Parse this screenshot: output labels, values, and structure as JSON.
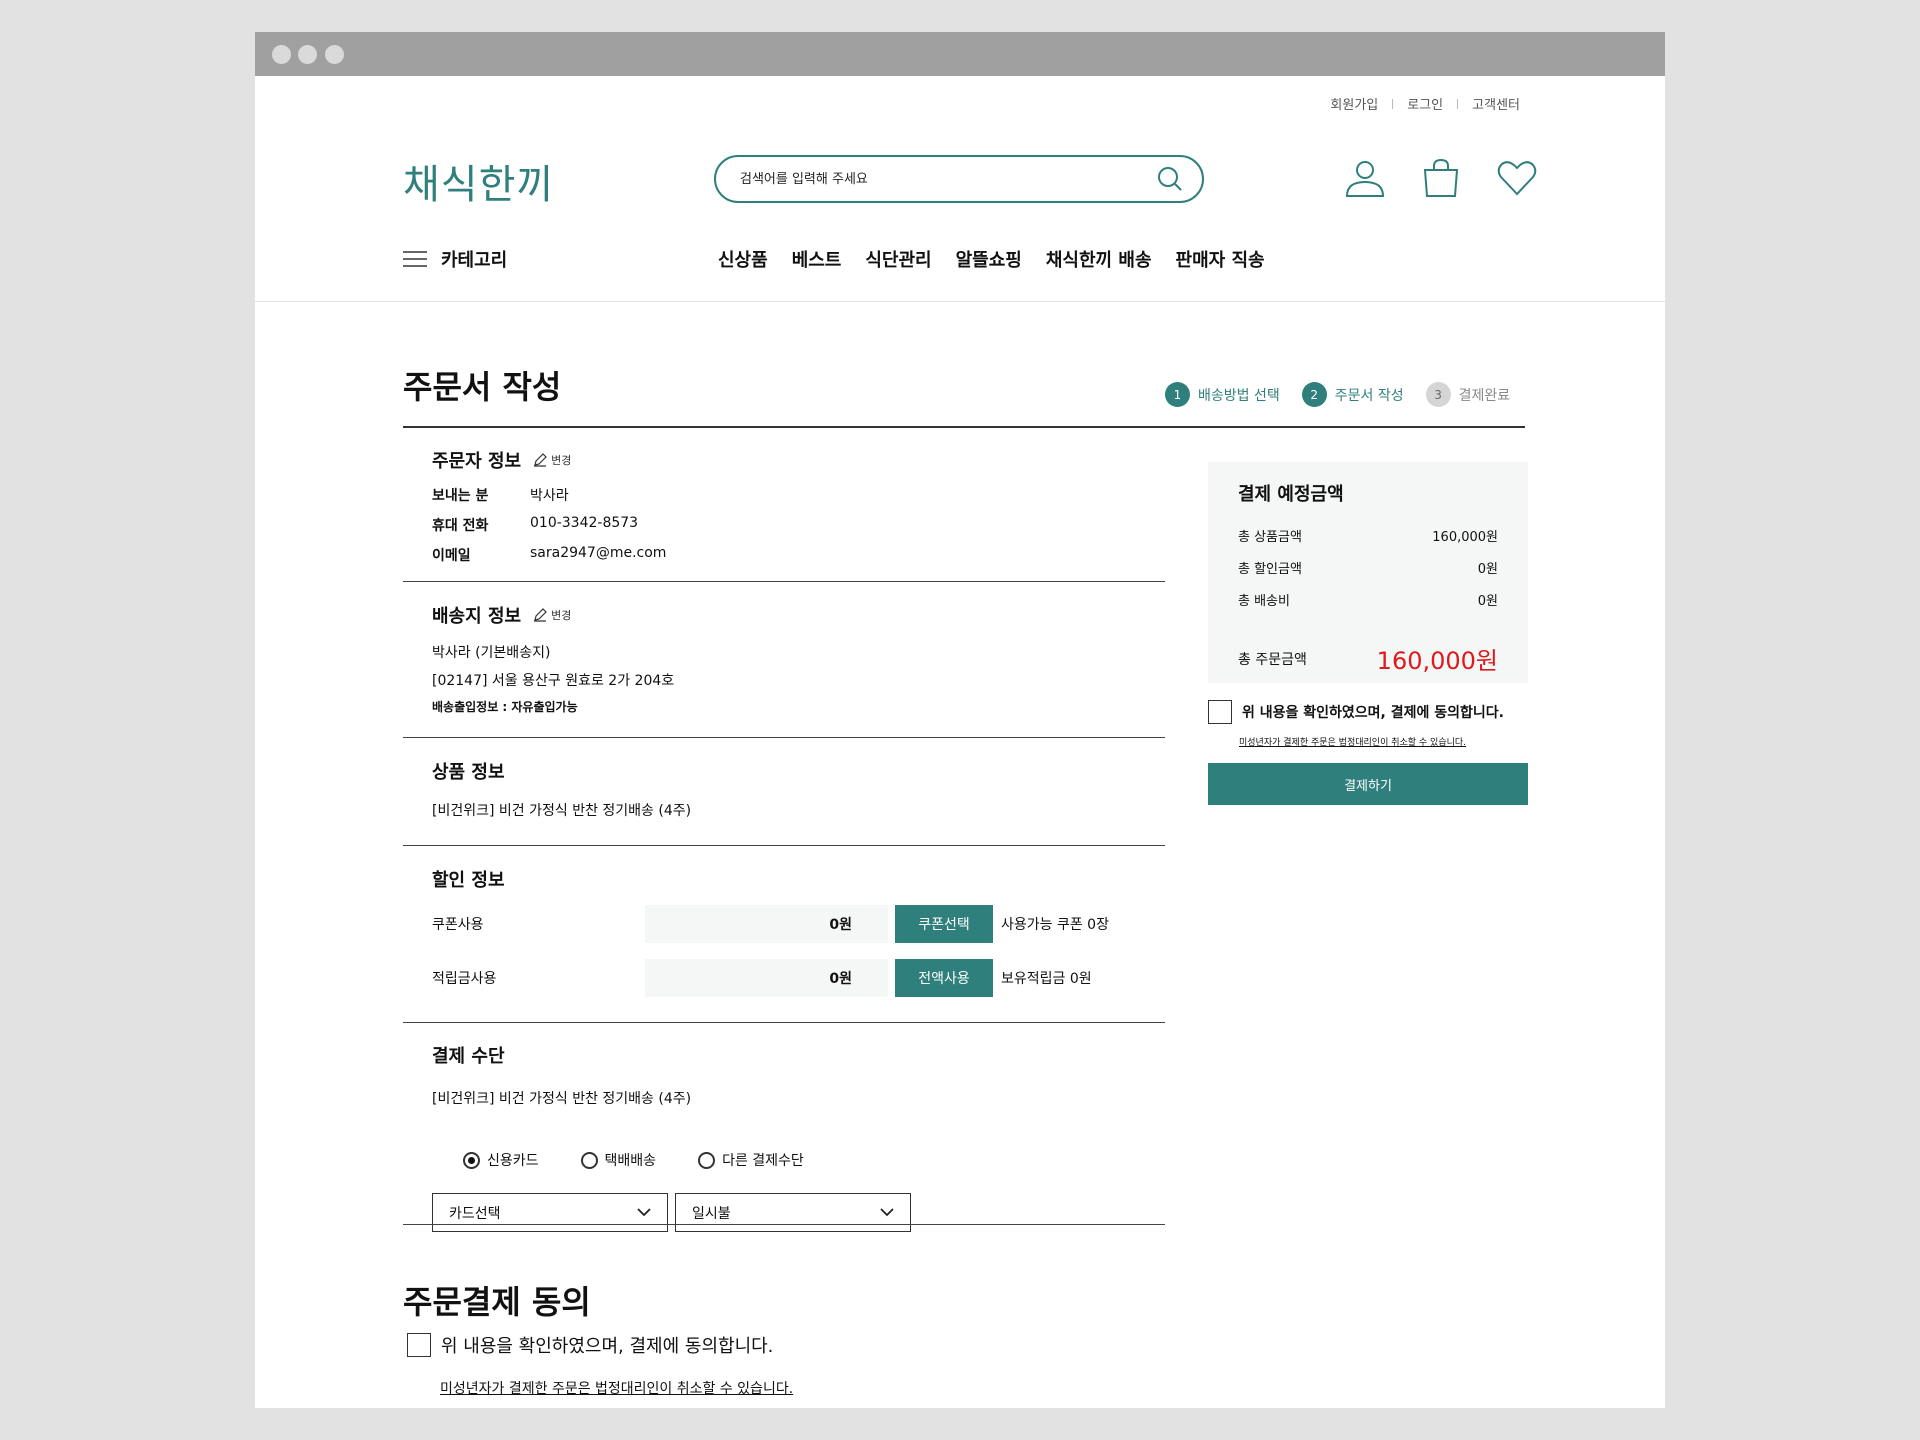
{
  "util_links": [
    "회원가입",
    "로그인",
    "고객센터"
  ],
  "logo": "채식한끼",
  "search": {
    "placeholder": "검색어를 입력해 주세요"
  },
  "nav": {
    "category_label": "카테고리",
    "menu": [
      "신상품",
      "베스트",
      "식단관리",
      "알뜰쇼핑",
      "채식한끼 배송",
      "판매자 직송"
    ]
  },
  "page": {
    "title": "주문서 작성"
  },
  "steps": [
    {
      "num": "1",
      "label": "배송방법 선택"
    },
    {
      "num": "2",
      "label": "주문서 작성"
    },
    {
      "num": "3",
      "label": "결제완료"
    }
  ],
  "orderer": {
    "title": "주문자 정보",
    "edit_label": "변경",
    "rows": [
      {
        "k": "보내는 분",
        "v": "박사라"
      },
      {
        "k": "휴대 전화",
        "v": "010-3342-8573"
      },
      {
        "k": "이메일",
        "v": "sara2947@me.com"
      }
    ]
  },
  "shipping": {
    "title": "배송지 정보",
    "edit_label": "변경",
    "name": "박사라 (기본배송지)",
    "address": "[02147] 서울 용산구 원효로 2가 204호",
    "entry_info": "배송출입정보 : 자유출입가능"
  },
  "product": {
    "title": "상품 정보",
    "name": "[비건위크] 비건 가정식 반찬 정기배송 (4주)"
  },
  "discount": {
    "title": "할인 정보",
    "coupon": {
      "label": "쿠폰사용",
      "value": "0원",
      "button": "쿠폰선택",
      "note": "사용가능 쿠폰 0장"
    },
    "points": {
      "label": "적립금사용",
      "value": "0원",
      "button": "전액사용",
      "note": "보유적립금 0원"
    }
  },
  "payment": {
    "title": "결제 수단",
    "product_name": "[비건위크] 비건 가정식 반찬 정기배송 (4주)",
    "methods": [
      "신용카드",
      "택배배송",
      "다른 결제수단"
    ],
    "card_select": "카드선택",
    "installment_select": "일시불"
  },
  "agreement": {
    "title": "주문결제 동의",
    "agree_text": "위 내용을 확인하였으며, 결제에 동의합니다.",
    "minor_notice": "미성년자가 결제한 주문은 법정대리인이 취소할 수 있습니다."
  },
  "summary": {
    "title": "결제 예정금액",
    "rows": [
      {
        "k": "총 상품금액",
        "v": "160,000원"
      },
      {
        "k": "총 할인금액",
        "v": "0원"
      },
      {
        "k": "총 배송비",
        "v": "0원"
      }
    ],
    "total_label": "총 주문금액",
    "total_value": "160,000원",
    "agree_text": "위 내용을 확인하였으며, 결제에 동의합니다.",
    "minor_notice": "미성년자가 결제한 주문은 법정대리인이 취소할 수 있습니다.",
    "pay_button": "결제하기"
  },
  "colors": {
    "accent": "#2f7f7d",
    "total": "#e0191c"
  }
}
